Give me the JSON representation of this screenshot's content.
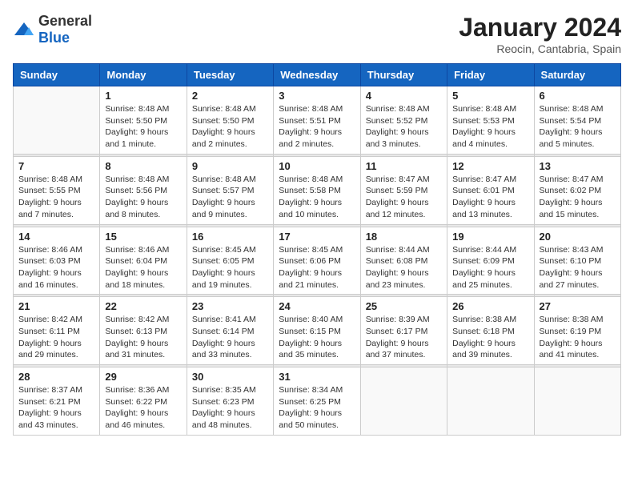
{
  "header": {
    "logo_general": "General",
    "logo_blue": "Blue",
    "month_year": "January 2024",
    "location": "Reocin, Cantabria, Spain"
  },
  "weekdays": [
    "Sunday",
    "Monday",
    "Tuesday",
    "Wednesday",
    "Thursday",
    "Friday",
    "Saturday"
  ],
  "weeks": [
    [
      {
        "day": "",
        "info": ""
      },
      {
        "day": "1",
        "info": "Sunrise: 8:48 AM\nSunset: 5:50 PM\nDaylight: 9 hours\nand 1 minute."
      },
      {
        "day": "2",
        "info": "Sunrise: 8:48 AM\nSunset: 5:50 PM\nDaylight: 9 hours\nand 2 minutes."
      },
      {
        "day": "3",
        "info": "Sunrise: 8:48 AM\nSunset: 5:51 PM\nDaylight: 9 hours\nand 2 minutes."
      },
      {
        "day": "4",
        "info": "Sunrise: 8:48 AM\nSunset: 5:52 PM\nDaylight: 9 hours\nand 3 minutes."
      },
      {
        "day": "5",
        "info": "Sunrise: 8:48 AM\nSunset: 5:53 PM\nDaylight: 9 hours\nand 4 minutes."
      },
      {
        "day": "6",
        "info": "Sunrise: 8:48 AM\nSunset: 5:54 PM\nDaylight: 9 hours\nand 5 minutes."
      }
    ],
    [
      {
        "day": "7",
        "info": "Sunrise: 8:48 AM\nSunset: 5:55 PM\nDaylight: 9 hours\nand 7 minutes."
      },
      {
        "day": "8",
        "info": "Sunrise: 8:48 AM\nSunset: 5:56 PM\nDaylight: 9 hours\nand 8 minutes."
      },
      {
        "day": "9",
        "info": "Sunrise: 8:48 AM\nSunset: 5:57 PM\nDaylight: 9 hours\nand 9 minutes."
      },
      {
        "day": "10",
        "info": "Sunrise: 8:48 AM\nSunset: 5:58 PM\nDaylight: 9 hours\nand 10 minutes."
      },
      {
        "day": "11",
        "info": "Sunrise: 8:47 AM\nSunset: 5:59 PM\nDaylight: 9 hours\nand 12 minutes."
      },
      {
        "day": "12",
        "info": "Sunrise: 8:47 AM\nSunset: 6:01 PM\nDaylight: 9 hours\nand 13 minutes."
      },
      {
        "day": "13",
        "info": "Sunrise: 8:47 AM\nSunset: 6:02 PM\nDaylight: 9 hours\nand 15 minutes."
      }
    ],
    [
      {
        "day": "14",
        "info": "Sunrise: 8:46 AM\nSunset: 6:03 PM\nDaylight: 9 hours\nand 16 minutes."
      },
      {
        "day": "15",
        "info": "Sunrise: 8:46 AM\nSunset: 6:04 PM\nDaylight: 9 hours\nand 18 minutes."
      },
      {
        "day": "16",
        "info": "Sunrise: 8:45 AM\nSunset: 6:05 PM\nDaylight: 9 hours\nand 19 minutes."
      },
      {
        "day": "17",
        "info": "Sunrise: 8:45 AM\nSunset: 6:06 PM\nDaylight: 9 hours\nand 21 minutes."
      },
      {
        "day": "18",
        "info": "Sunrise: 8:44 AM\nSunset: 6:08 PM\nDaylight: 9 hours\nand 23 minutes."
      },
      {
        "day": "19",
        "info": "Sunrise: 8:44 AM\nSunset: 6:09 PM\nDaylight: 9 hours\nand 25 minutes."
      },
      {
        "day": "20",
        "info": "Sunrise: 8:43 AM\nSunset: 6:10 PM\nDaylight: 9 hours\nand 27 minutes."
      }
    ],
    [
      {
        "day": "21",
        "info": "Sunrise: 8:42 AM\nSunset: 6:11 PM\nDaylight: 9 hours\nand 29 minutes."
      },
      {
        "day": "22",
        "info": "Sunrise: 8:42 AM\nSunset: 6:13 PM\nDaylight: 9 hours\nand 31 minutes."
      },
      {
        "day": "23",
        "info": "Sunrise: 8:41 AM\nSunset: 6:14 PM\nDaylight: 9 hours\nand 33 minutes."
      },
      {
        "day": "24",
        "info": "Sunrise: 8:40 AM\nSunset: 6:15 PM\nDaylight: 9 hours\nand 35 minutes."
      },
      {
        "day": "25",
        "info": "Sunrise: 8:39 AM\nSunset: 6:17 PM\nDaylight: 9 hours\nand 37 minutes."
      },
      {
        "day": "26",
        "info": "Sunrise: 8:38 AM\nSunset: 6:18 PM\nDaylight: 9 hours\nand 39 minutes."
      },
      {
        "day": "27",
        "info": "Sunrise: 8:38 AM\nSunset: 6:19 PM\nDaylight: 9 hours\nand 41 minutes."
      }
    ],
    [
      {
        "day": "28",
        "info": "Sunrise: 8:37 AM\nSunset: 6:21 PM\nDaylight: 9 hours\nand 43 minutes."
      },
      {
        "day": "29",
        "info": "Sunrise: 8:36 AM\nSunset: 6:22 PM\nDaylight: 9 hours\nand 46 minutes."
      },
      {
        "day": "30",
        "info": "Sunrise: 8:35 AM\nSunset: 6:23 PM\nDaylight: 9 hours\nand 48 minutes."
      },
      {
        "day": "31",
        "info": "Sunrise: 8:34 AM\nSunset: 6:25 PM\nDaylight: 9 hours\nand 50 minutes."
      },
      {
        "day": "",
        "info": ""
      },
      {
        "day": "",
        "info": ""
      },
      {
        "day": "",
        "info": ""
      }
    ]
  ]
}
